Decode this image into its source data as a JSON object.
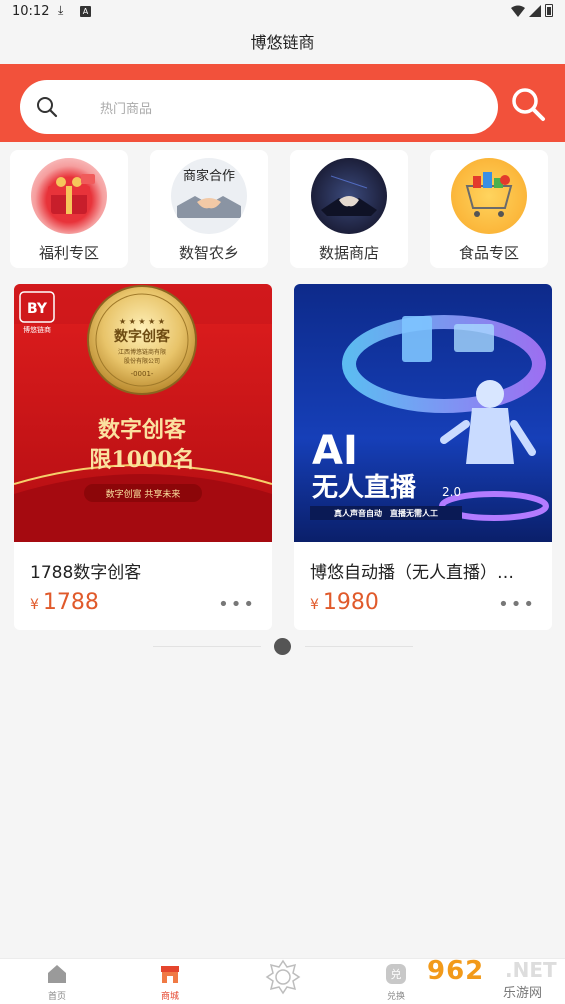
{
  "status": {
    "time": "10:12"
  },
  "header": {
    "title": "博悠链商"
  },
  "search": {
    "placeholder": "热门商品"
  },
  "categories": [
    {
      "label": "福利专区",
      "icon": "gift-icon"
    },
    {
      "label": "数智农乡",
      "icon": "handshake-icon"
    },
    {
      "label": "数据商店",
      "icon": "business-handshake-icon"
    },
    {
      "label": "食品专区",
      "icon": "shopping-cart-icon"
    }
  ],
  "products": [
    {
      "name": "1788数字创客",
      "currency": "¥",
      "price": "1788",
      "more": "•••",
      "image": {
        "logo": "BY",
        "logo_sub": "博悠链商",
        "badge_title": "数字创客",
        "badge_line1": "江西博悠链商有限",
        "badge_line2": "股份有限公司",
        "badge_no": "-0001-",
        "headline1": "数字创客",
        "headline2": "限1000名",
        "ribbon": "数字创富 共享未来"
      }
    },
    {
      "name": "博悠自动播（无人直播）…",
      "currency": "¥",
      "price": "1980",
      "more": "•••",
      "image": {
        "title1": "AI",
        "title2": "无人直播",
        "version": "2.0",
        "caption": "真人声音自动　直播无需人工"
      }
    }
  ],
  "tabbar": [
    {
      "label": "首页",
      "icon": "home-icon",
      "active": false
    },
    {
      "label": "商城",
      "icon": "shop-icon",
      "active": true
    },
    {
      "label": "",
      "icon": "badge-icon",
      "active": false
    },
    {
      "label": "兑换",
      "icon": "exchange-icon",
      "active": false
    }
  ],
  "watermark": {
    "num": "962",
    "net": ".NET",
    "cn": "乐游网"
  },
  "colors": {
    "accent": "#f2513b",
    "price": "#e05a2b"
  }
}
